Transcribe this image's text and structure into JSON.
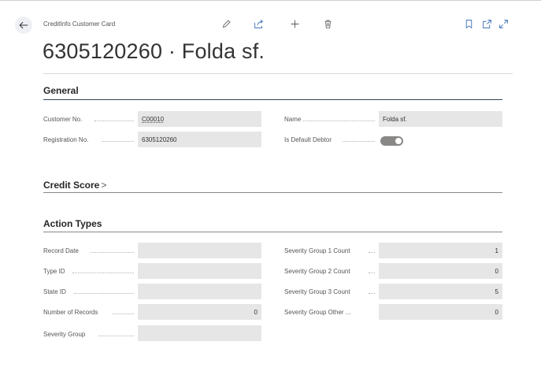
{
  "header": {
    "caption": "CreditInfo Customer Card",
    "title": "6305120260 · Folda sf.",
    "toolbar_icons": [
      "edit-icon",
      "share-icon",
      "add-icon",
      "delete-icon",
      "bookmark-icon",
      "open-new-window-icon",
      "expand-icon"
    ]
  },
  "general": {
    "title": "General",
    "customer_no_label": "Customer No.",
    "customer_no_value": "C00010",
    "registration_no_label": "Registration No.",
    "registration_no_value": "6305120260",
    "name_label": "Name",
    "name_value": "Folda sf.",
    "default_debtor_label": "Is Default Debtor",
    "default_debtor_value": true
  },
  "credit_score": {
    "title": "Credit Score",
    "chevron": ">"
  },
  "action_types": {
    "title": "Action Types",
    "left_fields": [
      {
        "label": "Record Date",
        "value": ""
      },
      {
        "label": "Type ID",
        "value": ""
      },
      {
        "label": "State ID",
        "value": ""
      },
      {
        "label": "Number of Records",
        "value": "0"
      },
      {
        "label": "Severity Group",
        "value": ""
      }
    ],
    "right_fields": [
      {
        "label": "Severity Group 1 Count",
        "value": "1"
      },
      {
        "label": "Severity Group 2 Count",
        "value": "0"
      },
      {
        "label": "Severity Group 3 Count",
        "value": "5"
      },
      {
        "label": "Severity Group Other ...",
        "value": "0"
      }
    ]
  },
  "colors": {
    "accent_line": "#33455a",
    "field_bg": "#e6e6e6",
    "toggle_on": "#8a8886"
  }
}
